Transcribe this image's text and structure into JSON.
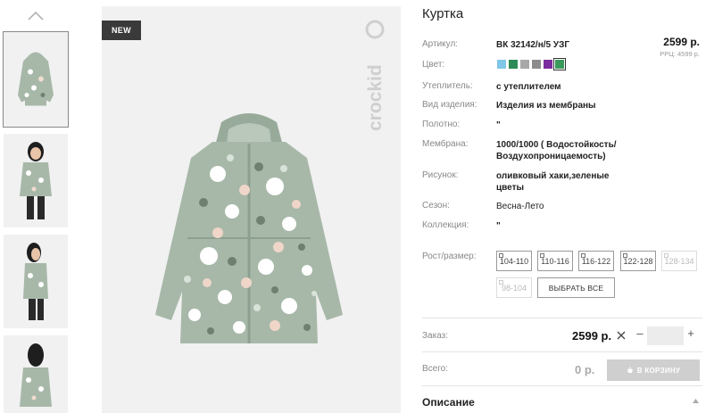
{
  "badge": "NEW",
  "brand_logo_text": "crockid",
  "product": {
    "title": "Куртка",
    "price": "2599 р.",
    "rrp": "РРЦ: 4599 р."
  },
  "specs": {
    "article_label": "Артикул:",
    "article_value": "ВК 32142/н/5 УЗГ",
    "color_label": "Цвет:",
    "insulation_label": "Утеплитель:",
    "insulation_value": "с утеплителем",
    "type_label": "Вид изделия:",
    "type_value": "Изделия из мембраны",
    "fabric_label": "Полотно:",
    "fabric_value": "\"",
    "membrane_label": "Мембрана:",
    "membrane_value": "1000/1000 ( Водостойкость/ Воздухопроницаемость)",
    "pattern_label": "Рисунок:",
    "pattern_value": "оливковый хаки,зеленые цветы",
    "season_label": "Сезон:",
    "season_value": "Весна-Лето",
    "collection_label": "Коллекция:",
    "collection_value": "\"",
    "size_label": "Рост/размер:"
  },
  "swatches": [
    {
      "color": "#7fc6e8",
      "selected": false
    },
    {
      "color": "#2e8b57",
      "selected": false
    },
    {
      "color": "#a8a8a8",
      "selected": false
    },
    {
      "color": "#8c8c8c",
      "selected": false
    },
    {
      "color": "#7b2d9e",
      "selected": false
    },
    {
      "color": "#3a9a5c",
      "selected": true
    }
  ],
  "sizes": [
    {
      "label": "104-110",
      "disabled": false
    },
    {
      "label": "110-116",
      "disabled": false
    },
    {
      "label": "116-122",
      "disabled": false
    },
    {
      "label": "122-128",
      "disabled": false
    },
    {
      "label": "128-134",
      "disabled": true
    },
    {
      "label": "98-104",
      "disabled": true
    }
  ],
  "select_all_label": "ВЫБРАТЬ ВСЕ",
  "order": {
    "label": "Заказ:",
    "price": "2599 р.",
    "minus": "–",
    "plus": "+",
    "qty": ""
  },
  "total": {
    "label": "Всего:",
    "value": "0 р.",
    "cart_button": "В КОРЗИНУ"
  },
  "description_title": "Описание",
  "colors": {
    "jacket": "#a7b8a8",
    "jacket_dark": "#8d9f8f",
    "badge_bg": "#3a3a3a",
    "cart_button_bg": "#cfcfcf"
  }
}
